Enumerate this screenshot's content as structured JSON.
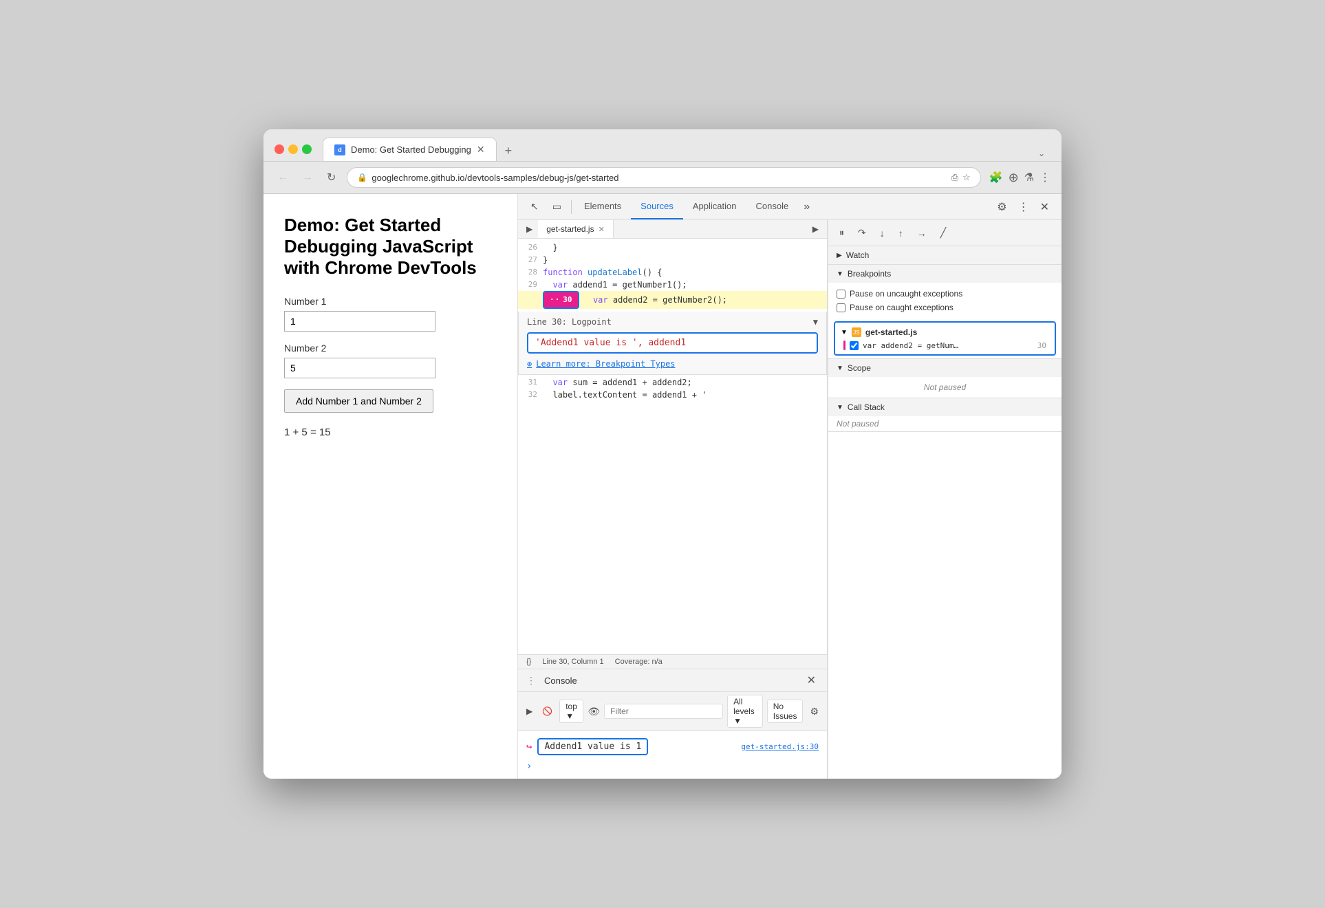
{
  "browser": {
    "tab_title": "Demo: Get Started Debugging",
    "url": "googlechrome.github.io/devtools-samples/debug-js/get-started",
    "new_tab_label": "+",
    "back_label": "←",
    "forward_label": "→",
    "refresh_label": "↻"
  },
  "webpage": {
    "title": "Demo: Get Started Debugging JavaScript with Chrome DevTools",
    "number1_label": "Number 1",
    "number1_value": "1",
    "number2_label": "Number 2",
    "number2_value": "5",
    "button_label": "Add Number 1 and Number 2",
    "result": "1 + 5 = 15"
  },
  "devtools": {
    "tabs": [
      "Elements",
      "Sources",
      "Application",
      "Console"
    ],
    "active_tab": "Sources",
    "file_name": "get-started.js",
    "code_lines": [
      {
        "num": "26",
        "content": "  }"
      },
      {
        "num": "27",
        "content": "}"
      },
      {
        "num": "28",
        "content": "function updateLabel() {"
      },
      {
        "num": "29",
        "content": "  var addend1 = getNumber1();"
      },
      {
        "num": "30",
        "content": "  var addend2 = getNumber2();"
      },
      {
        "num": "31",
        "content": "  var sum = addend1 + addend2;"
      },
      {
        "num": "32",
        "content": "  label.textContent = addend1 + '"
      }
    ],
    "breakpoint_line": "30",
    "breakpoint_value": "30",
    "logpoint_header": "Line 30:  Logpoint",
    "logpoint_expression": "'Addend1 value is ', addend1",
    "logpoint_link": "Learn more: Breakpoint Types",
    "status_bar": {
      "curly": "{}",
      "position": "Line 30, Column 1",
      "coverage": "Coverage: n/a"
    },
    "console": {
      "title": "Console",
      "filter_placeholder": "Filter",
      "top_label": "top ▼",
      "all_levels": "All levels ▼",
      "no_issues": "No Issues",
      "log_text": "Addend1 value is  1",
      "log_link": "get-started.js:30"
    },
    "debugger": {
      "watch_label": "Watch",
      "breakpoints_label": "Breakpoints",
      "pause_uncaught": "Pause on uncaught exceptions",
      "pause_caught": "Pause on caught exceptions",
      "file_label": "get-started.js",
      "bp_code": "var addend2 = getNum…",
      "bp_num": "30",
      "scope_label": "Scope",
      "scope_status": "Not paused",
      "callstack_label": "Call Stack",
      "callstack_status": "Not paused"
    }
  }
}
